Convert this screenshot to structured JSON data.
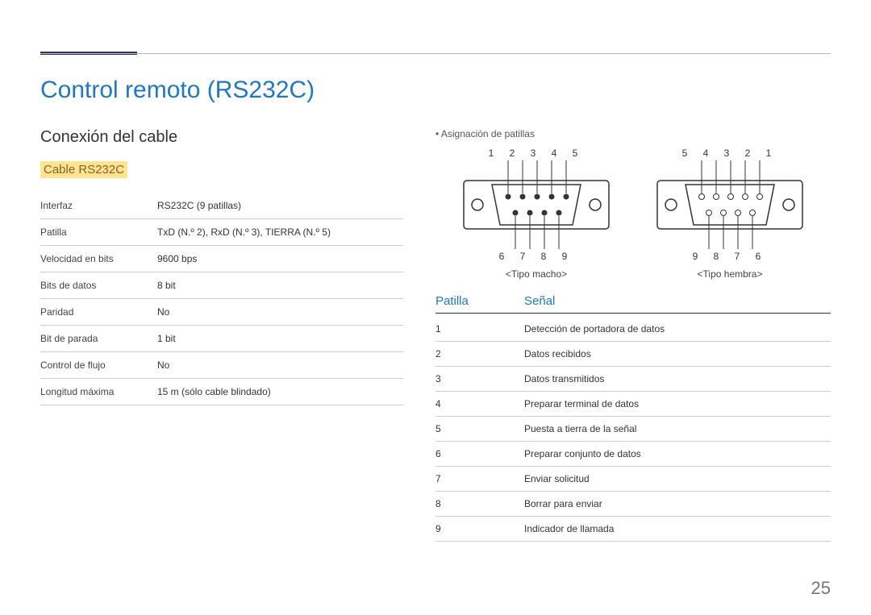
{
  "page": {
    "title": "Control remoto (RS232C)",
    "pageNumber": "25"
  },
  "left": {
    "subtitle": "Conexión del cable",
    "subhead": "Cable RS232C",
    "specs": [
      {
        "label": "Interfaz",
        "value": "RS232C (9 patillas)"
      },
      {
        "label": "Patilla",
        "value": "TxD (N.º 2), RxD (N.º 3), TIERRA (N.º 5)"
      },
      {
        "label": "Velocidad en bits",
        "value": "9600 bps"
      },
      {
        "label": "Bits de datos",
        "value": "8 bit"
      },
      {
        "label": "Paridad",
        "value": "No"
      },
      {
        "label": "Bit de parada",
        "value": "1 bit"
      },
      {
        "label": "Control de flujo",
        "value": "No"
      },
      {
        "label": "Longitud máxima",
        "value": "15 m (sólo cable blindado)"
      }
    ]
  },
  "right": {
    "bullet": "Asignación de patillas",
    "diagrams": {
      "male": {
        "topNums": "1 2 3 4 5",
        "botNums": "6 7 8 9",
        "caption": "<Tipo macho>"
      },
      "female": {
        "topNums": "5 4 3 2 1",
        "botNums": "9 8 7 6",
        "caption": "<Tipo hembra>"
      }
    },
    "signalHeader": {
      "pin": "Patilla",
      "signal": "Señal"
    },
    "signals": [
      {
        "pin": "1",
        "signal": "Detección de portadora de datos"
      },
      {
        "pin": "2",
        "signal": "Datos recibidos"
      },
      {
        "pin": "3",
        "signal": "Datos transmitidos"
      },
      {
        "pin": "4",
        "signal": "Preparar terminal de datos"
      },
      {
        "pin": "5",
        "signal": "Puesta a tierra de la señal"
      },
      {
        "pin": "6",
        "signal": "Preparar conjunto de datos"
      },
      {
        "pin": "7",
        "signal": "Enviar solicitud"
      },
      {
        "pin": "8",
        "signal": "Borrar para enviar"
      },
      {
        "pin": "9",
        "signal": "Indicador de llamada"
      }
    ]
  }
}
